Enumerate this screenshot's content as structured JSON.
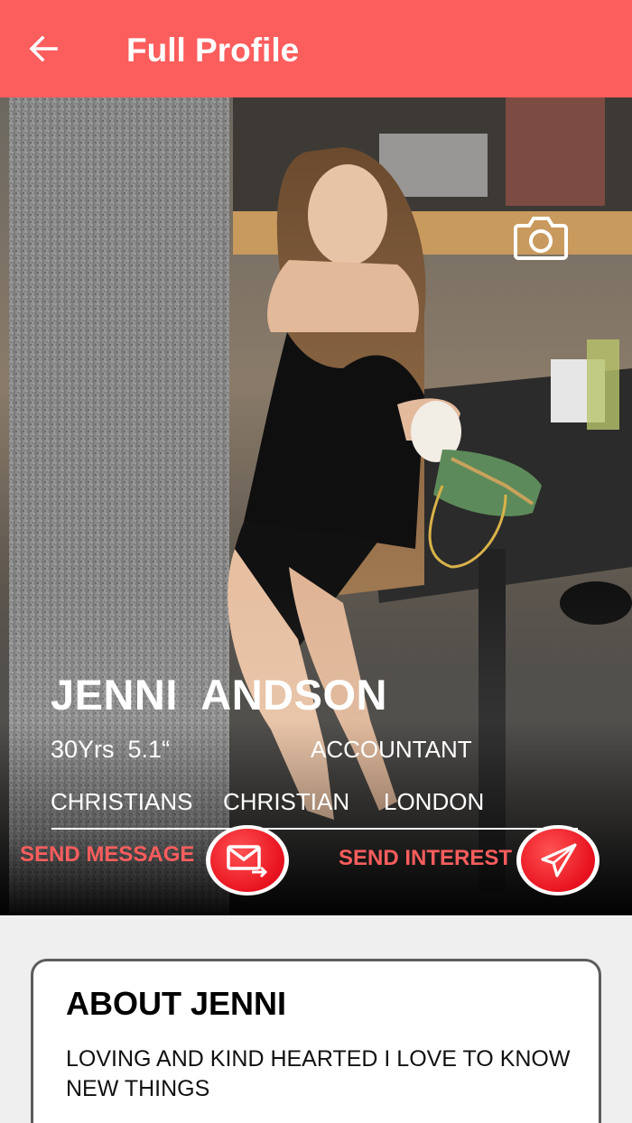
{
  "header": {
    "title": "Full Profile",
    "back_icon": "arrow-left-icon",
    "background": "#fc5d5d"
  },
  "profile": {
    "name": "JENNI  ANDSON",
    "stats": "30Yrs  5.1“",
    "profession": "ACCOUNTANT",
    "tags": [
      "CHRISTIANS",
      "CHRISTIAN",
      "LONDON"
    ],
    "camera_icon": "camera-icon"
  },
  "actions": {
    "send_message_label": "SEND MESSAGE",
    "send_message_icon": "mail-forward-icon",
    "send_interest_label": "SEND INTEREST",
    "send_interest_icon": "paper-plane-icon",
    "accent": "#fc5d5d",
    "button_color": "#e8121f"
  },
  "about": {
    "title": "ABOUT JENNI",
    "text": "LOVING AND KIND HEARTED I LOVE TO KNOW NEW THINGS"
  }
}
